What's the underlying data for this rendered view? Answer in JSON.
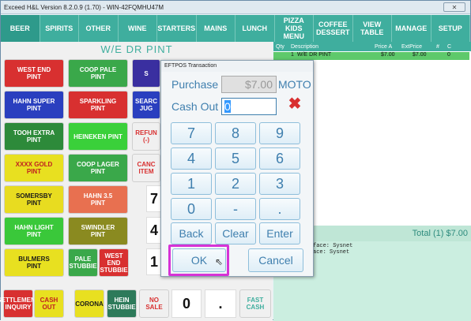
{
  "window": {
    "title": "Exceed H&L Version 8.2.0.9 (1.70) - WIN-42FQMHU47M",
    "close_icon": "close-icon"
  },
  "menu": [
    "BEER",
    "SPIRITS",
    "OTHER",
    "WINE",
    "STARTERS",
    "MAINS",
    "LUNCH",
    "PIZZA\nKIDS\nMENU",
    "COFFEE\nDESSERT",
    "VIEW\nTABLE",
    "MANAGE",
    "SETUP"
  ],
  "panel_title": "W/E DR PINT",
  "products": [
    {
      "label": "WEST END\nPINT",
      "color": "#d83030"
    },
    {
      "label": "COOP PALE\nPINT",
      "color": "#3aa84a"
    },
    {
      "label": "HAHN SUPER\nPINT",
      "color": "#2a3fbf"
    },
    {
      "label": "SPARKLING\nPINT",
      "color": "#d83030"
    },
    {
      "label": "TOOH EXTRA\nPINT",
      "color": "#2d8a3a"
    },
    {
      "label": "HEINEKEN PINT",
      "color": "#3ad03a"
    },
    {
      "label": "XXXX GOLD\nPINT",
      "color": "#e8e020",
      "text": "#c02020"
    },
    {
      "label": "COOP LAGER\nPINT",
      "color": "#3aa84a"
    },
    {
      "label": "SOMERSBY\nPINT",
      "color": "#e8dc20",
      "text": "#1a1a1a"
    },
    {
      "label": "HAHN 3.5\nPINT",
      "color": "#e87050"
    },
    {
      "label": "HAHN LIGHT\nPINT",
      "color": "#3ac83a"
    },
    {
      "label": "SWINDLER\nPINT",
      "color": "#8a8a20"
    },
    {
      "label": "BULMERS\nPINT",
      "color": "#e8e020",
      "text": "#1a1a1a"
    },
    {
      "label": "PALE\nSTUBBIE",
      "color": "#3aa84a"
    },
    {
      "label": "WEST\nEND\nSTUBBIE",
      "color": "#d83030"
    }
  ],
  "side_partial": [
    "S",
    "SEARC\nJUG",
    "REFUN\n(-)",
    "CANC\nITEM"
  ],
  "bottom_row": [
    {
      "label": "SETTLEMENT\nINQUIRY",
      "color": "#d83030"
    },
    {
      "label": "CASH\nOUT",
      "color": "#e8e020",
      "text": "#c02020"
    },
    {
      "label": "CORONA",
      "color": "#e8e020",
      "text": "#1a1a1a"
    },
    {
      "label": "HEIN\nSTUBBIE",
      "color": "#2d7a5a"
    },
    {
      "label": "NO\nSALE",
      "color": "#f0f0f0",
      "text": "#d83030"
    }
  ],
  "bg_numpad": [
    "7",
    "4",
    "1",
    "0",
    "."
  ],
  "fast_cash": "FAST\nCASH",
  "order": {
    "headers": [
      "Qty",
      "Description",
      "Price A",
      "ExtPrice",
      "#",
      "C"
    ],
    "row": {
      "qty": "1",
      "desc": "W/E DR PINT",
      "price": "$7.00",
      "ext": "$7.00",
      "num": "0"
    },
    "total": "Total (1) $7.00",
    "notes": [
      "face: Sysnet",
      "ace: Sysnet"
    ]
  },
  "eftpos": {
    "title": "EFTPOS Transaction",
    "purchase_label": "Purchase",
    "purchase_value": "$7.00",
    "moto_label": "MOTO",
    "cashout_label": "Cash Out",
    "cashout_value": "0",
    "keys": [
      "7",
      "8",
      "9",
      "4",
      "5",
      "6",
      "1",
      "2",
      "3",
      "0",
      "-",
      "."
    ],
    "back": "Back",
    "clear": "Clear",
    "enter": "Enter",
    "ok": "OK",
    "cancel": "Cancel"
  }
}
